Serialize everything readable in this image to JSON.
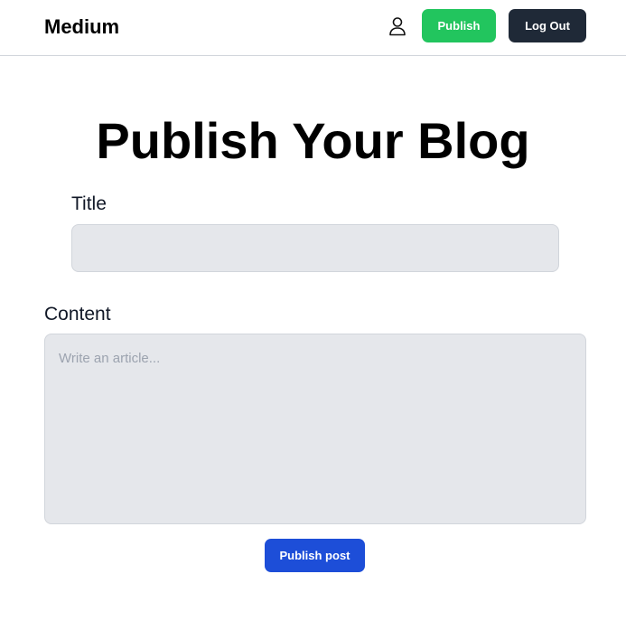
{
  "navbar": {
    "brand": "Medium",
    "user_icon": "user-icon",
    "publish_label": "Publish",
    "logout_label": "Log Out"
  },
  "main": {
    "heading": "Publish Your Blog",
    "title_label": "Title",
    "title_value": "",
    "content_label": "Content",
    "content_value": "",
    "content_placeholder": "Write an article...",
    "submit_label": "Publish post"
  },
  "colors": {
    "publish_button": "#22c55e",
    "logout_button": "#1f2937",
    "submit_button": "#1d4ed8",
    "input_background": "#e5e7eb"
  }
}
